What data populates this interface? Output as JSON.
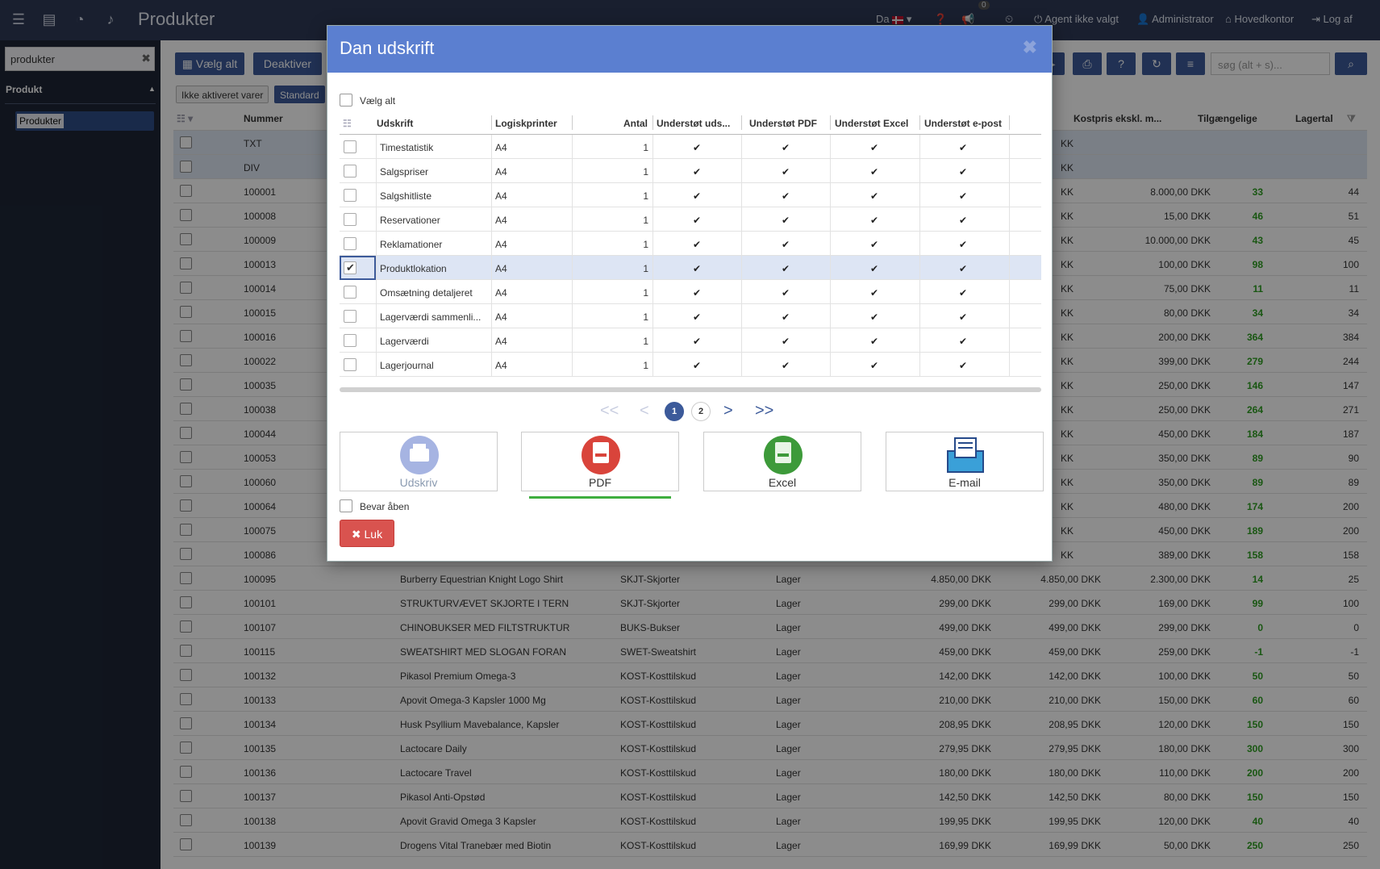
{
  "topbar": {
    "title": "Produkter",
    "lang": "Da",
    "badge": "0",
    "agent": "Agent ikke valgt",
    "user": "Administrator",
    "office": "Hovedkontor",
    "logout": "Log af"
  },
  "sidebar": {
    "search": "produkter",
    "section": "Produkt",
    "item": "Produkter"
  },
  "toolbar": {
    "select_all": "Vælg alt",
    "deactivate": "Deaktiver",
    "search_placeholder": "søg (alt + s)..."
  },
  "filters": {
    "inactive": "Ikke aktiveret varer",
    "standard": "Standard"
  },
  "grid": {
    "headers": {
      "number": "Nummer",
      "cost": "Kostpris ekskl. m...",
      "available": "Tilgængelige",
      "stock": "Lagertal"
    },
    "rows": [
      {
        "num": "TXT",
        "name": "",
        "group": "",
        "type": "",
        "p1": "",
        "p2": "",
        "cur": "KK",
        "cost": "",
        "avail": "",
        "stock": ""
      },
      {
        "num": "DIV",
        "name": "",
        "group": "",
        "type": "",
        "p1": "",
        "p2": "",
        "cur": "KK",
        "cost": "",
        "avail": "",
        "stock": ""
      },
      {
        "num": "100001",
        "name": "",
        "group": "",
        "type": "",
        "p1": "",
        "p2": "",
        "cur": "KK",
        "cost": "8.000,00 DKK",
        "avail": "33",
        "stock": "44"
      },
      {
        "num": "100008",
        "name": "",
        "group": "",
        "type": "",
        "p1": "",
        "p2": "",
        "cur": "KK",
        "cost": "15,00 DKK",
        "avail": "46",
        "stock": "51"
      },
      {
        "num": "100009",
        "name": "",
        "group": "",
        "type": "",
        "p1": "",
        "p2": "",
        "cur": "KK",
        "cost": "10.000,00 DKK",
        "avail": "43",
        "stock": "45"
      },
      {
        "num": "100013",
        "name": "",
        "group": "",
        "type": "",
        "p1": "",
        "p2": "",
        "cur": "KK",
        "cost": "100,00 DKK",
        "avail": "98",
        "stock": "100"
      },
      {
        "num": "100014",
        "name": "",
        "group": "",
        "type": "",
        "p1": "",
        "p2": "",
        "cur": "KK",
        "cost": "75,00 DKK",
        "avail": "11",
        "stock": "11"
      },
      {
        "num": "100015",
        "name": "",
        "group": "",
        "type": "",
        "p1": "",
        "p2": "",
        "cur": "KK",
        "cost": "80,00 DKK",
        "avail": "34",
        "stock": "34"
      },
      {
        "num": "100016",
        "name": "",
        "group": "",
        "type": "",
        "p1": "",
        "p2": "",
        "cur": "KK",
        "cost": "200,00 DKK",
        "avail": "364",
        "stock": "384"
      },
      {
        "num": "100022",
        "name": "",
        "group": "",
        "type": "",
        "p1": "",
        "p2": "",
        "cur": "KK",
        "cost": "399,00 DKK",
        "avail": "279",
        "stock": "244"
      },
      {
        "num": "100035",
        "name": "",
        "group": "",
        "type": "",
        "p1": "",
        "p2": "",
        "cur": "KK",
        "cost": "250,00 DKK",
        "avail": "146",
        "stock": "147"
      },
      {
        "num": "100038",
        "name": "",
        "group": "",
        "type": "",
        "p1": "",
        "p2": "",
        "cur": "KK",
        "cost": "250,00 DKK",
        "avail": "264",
        "stock": "271"
      },
      {
        "num": "100044",
        "name": "",
        "group": "",
        "type": "",
        "p1": "",
        "p2": "",
        "cur": "KK",
        "cost": "450,00 DKK",
        "avail": "184",
        "stock": "187"
      },
      {
        "num": "100053",
        "name": "",
        "group": "",
        "type": "",
        "p1": "",
        "p2": "",
        "cur": "KK",
        "cost": "350,00 DKK",
        "avail": "89",
        "stock": "90"
      },
      {
        "num": "100060",
        "name": "",
        "group": "",
        "type": "",
        "p1": "",
        "p2": "",
        "cur": "KK",
        "cost": "350,00 DKK",
        "avail": "89",
        "stock": "89"
      },
      {
        "num": "100064",
        "name": "",
        "group": "",
        "type": "",
        "p1": "",
        "p2": "",
        "cur": "KK",
        "cost": "480,00 DKK",
        "avail": "174",
        "stock": "200"
      },
      {
        "num": "100075",
        "name": "",
        "group": "",
        "type": "",
        "p1": "",
        "p2": "",
        "cur": "KK",
        "cost": "450,00 DKK",
        "avail": "189",
        "stock": "200"
      },
      {
        "num": "100086",
        "name": "",
        "group": "",
        "type": "",
        "p1": "",
        "p2": "",
        "cur": "KK",
        "cost": "389,00 DKK",
        "avail": "158",
        "stock": "158"
      },
      {
        "num": "100095",
        "name": "Burberry Equestrian Knight Logo Shirt",
        "group": "SKJT-Skjorter",
        "type": "Lager",
        "p1": "4.850,00 DKK",
        "p2": "4.850,00 DKK",
        "cur": "",
        "cost": "2.300,00 DKK",
        "avail": "14",
        "stock": "25"
      },
      {
        "num": "100101",
        "name": "STRUKTURVÆVET SKJORTE I TERN",
        "group": "SKJT-Skjorter",
        "type": "Lager",
        "p1": "299,00 DKK",
        "p2": "299,00 DKK",
        "cur": "",
        "cost": "169,00 DKK",
        "avail": "99",
        "stock": "100"
      },
      {
        "num": "100107",
        "name": "CHINOBUKSER MED FILTSTRUKTUR",
        "group": "BUKS-Bukser",
        "type": "Lager",
        "p1": "499,00 DKK",
        "p2": "499,00 DKK",
        "cur": "",
        "cost": "299,00 DKK",
        "avail": "0",
        "stock": "0"
      },
      {
        "num": "100115",
        "name": "SWEATSHIRT MED SLOGAN FORAN",
        "group": "SWET-Sweatshirt",
        "type": "Lager",
        "p1": "459,00 DKK",
        "p2": "459,00 DKK",
        "cur": "",
        "cost": "259,00 DKK",
        "avail": "-1",
        "stock": "-1"
      },
      {
        "num": "100132",
        "name": "Pikasol Premium Omega-3",
        "group": "KOST-Kosttilskud",
        "type": "Lager",
        "p1": "142,00 DKK",
        "p2": "142,00 DKK",
        "cur": "",
        "cost": "100,00 DKK",
        "avail": "50",
        "stock": "50"
      },
      {
        "num": "100133",
        "name": "Apovit Omega-3 Kapsler 1000 Mg",
        "group": "KOST-Kosttilskud",
        "type": "Lager",
        "p1": "210,00 DKK",
        "p2": "210,00 DKK",
        "cur": "",
        "cost": "150,00 DKK",
        "avail": "60",
        "stock": "60"
      },
      {
        "num": "100134",
        "name": "Husk Psyllium Mavebalance, Kapsler",
        "group": "KOST-Kosttilskud",
        "type": "Lager",
        "p1": "208,95 DKK",
        "p2": "208,95 DKK",
        "cur": "",
        "cost": "120,00 DKK",
        "avail": "150",
        "stock": "150"
      },
      {
        "num": "100135",
        "name": "Lactocare Daily",
        "group": "KOST-Kosttilskud",
        "type": "Lager",
        "p1": "279,95 DKK",
        "p2": "279,95 DKK",
        "cur": "",
        "cost": "180,00 DKK",
        "avail": "300",
        "stock": "300"
      },
      {
        "num": "100136",
        "name": "Lactocare Travel",
        "group": "KOST-Kosttilskud",
        "type": "Lager",
        "p1": "180,00 DKK",
        "p2": "180,00 DKK",
        "cur": "",
        "cost": "110,00 DKK",
        "avail": "200",
        "stock": "200"
      },
      {
        "num": "100137",
        "name": "Pikasol Anti-Opstød",
        "group": "KOST-Kosttilskud",
        "type": "Lager",
        "p1": "142,50 DKK",
        "p2": "142,50 DKK",
        "cur": "",
        "cost": "80,00 DKK",
        "avail": "150",
        "stock": "150"
      },
      {
        "num": "100138",
        "name": "Apovit Gravid Omega 3 Kapsler",
        "group": "KOST-Kosttilskud",
        "type": "Lager",
        "p1": "199,95 DKK",
        "p2": "199,95 DKK",
        "cur": "",
        "cost": "120,00 DKK",
        "avail": "40",
        "stock": "40"
      },
      {
        "num": "100139",
        "name": "Drogens Vital Tranebær med Biotin",
        "group": "KOST-Kosttilskud",
        "type": "Lager",
        "p1": "169,99 DKK",
        "p2": "169,99 DKK",
        "cur": "",
        "cost": "50,00 DKK",
        "avail": "250",
        "stock": "250"
      }
    ]
  },
  "modal": {
    "title": "Dan udskrift",
    "select_all": "Vælg alt",
    "headers": {
      "udskrift": "Udskrift",
      "printer": "Logiskprinter",
      "antal": "Antal",
      "sup_print": "Understøt uds...",
      "sup_pdf": "Understøt PDF",
      "sup_excel": "Understøt Excel",
      "sup_email": "Understøt e-post"
    },
    "rows": [
      {
        "name": "Timestatistik",
        "printer": "A4",
        "antal": "1",
        "selected": false
      },
      {
        "name": "Salgspriser",
        "printer": "A4",
        "antal": "1",
        "selected": false
      },
      {
        "name": "Salgshitliste",
        "printer": "A4",
        "antal": "1",
        "selected": false
      },
      {
        "name": "Reservationer",
        "printer": "A4",
        "antal": "1",
        "selected": false
      },
      {
        "name": "Reklamationer",
        "printer": "A4",
        "antal": "1",
        "selected": false
      },
      {
        "name": "Produktlokation",
        "printer": "A4",
        "antal": "1",
        "selected": true
      },
      {
        "name": "Omsætning detaljeret",
        "printer": "A4",
        "antal": "1",
        "selected": false
      },
      {
        "name": "Lagerværdi sammenli...",
        "printer": "A4",
        "antal": "1",
        "selected": false
      },
      {
        "name": "Lagerværdi",
        "printer": "A4",
        "antal": "1",
        "selected": false
      },
      {
        "name": "Lagerjournal",
        "printer": "A4",
        "antal": "1",
        "selected": false
      }
    ],
    "pagination": {
      "first": "<<",
      "prev": "<",
      "pages": [
        "1",
        "2"
      ],
      "next": ">",
      "last": ">>"
    },
    "outputs": {
      "print": "Udskriv",
      "pdf": "PDF",
      "excel": "Excel",
      "email": "E-mail"
    },
    "keep_open": "Bevar åben",
    "close": "Luk"
  }
}
